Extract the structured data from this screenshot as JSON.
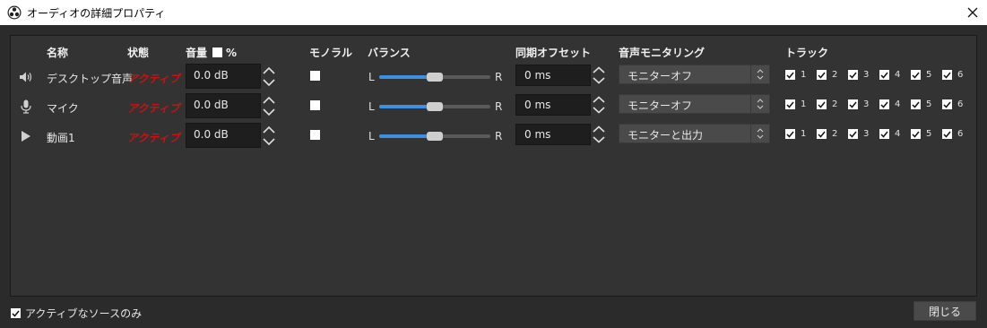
{
  "window": {
    "title": "オーディオの詳細プロパティ"
  },
  "headers": {
    "name": "名称",
    "status": "状態",
    "volume": "音量",
    "percent": "%",
    "mono": "モノラル",
    "balance": "バランス",
    "sync_offset": "同期オフセット",
    "monitoring": "音声モニタリング",
    "tracks": "トラック"
  },
  "rows": [
    {
      "icon": "speaker-icon",
      "name": "デスクトップ音声",
      "status": "アクティブ",
      "volume": "0.0 dB",
      "mono": false,
      "balance_L": "L",
      "balance_R": "R",
      "balance": 0.5,
      "offset": "0 ms",
      "monitoring": "モニターオフ",
      "tracks": [
        "1",
        "2",
        "3",
        "4",
        "5",
        "6"
      ]
    },
    {
      "icon": "microphone-icon",
      "name": "マイク",
      "status": "アクティブ",
      "volume": "0.0 dB",
      "mono": false,
      "balance_L": "L",
      "balance_R": "R",
      "balance": 0.5,
      "offset": "0 ms",
      "monitoring": "モニターオフ",
      "tracks": [
        "1",
        "2",
        "3",
        "4",
        "5",
        "6"
      ]
    },
    {
      "icon": "play-icon",
      "name": "動画1",
      "status": "アクティブ",
      "volume": "0.0 dB",
      "mono": false,
      "balance_L": "L",
      "balance_R": "R",
      "balance": 0.5,
      "offset": "0 ms",
      "monitoring": "モニターと出力",
      "tracks": [
        "1",
        "2",
        "3",
        "4",
        "5",
        "6"
      ]
    }
  ],
  "footer": {
    "active_only_label": "アクティブなソースのみ",
    "close_label": "閉じる"
  },
  "colors": {
    "status": "#cc1111",
    "slider_fill": "#3d8fe0",
    "background": "#2b2b2b"
  }
}
